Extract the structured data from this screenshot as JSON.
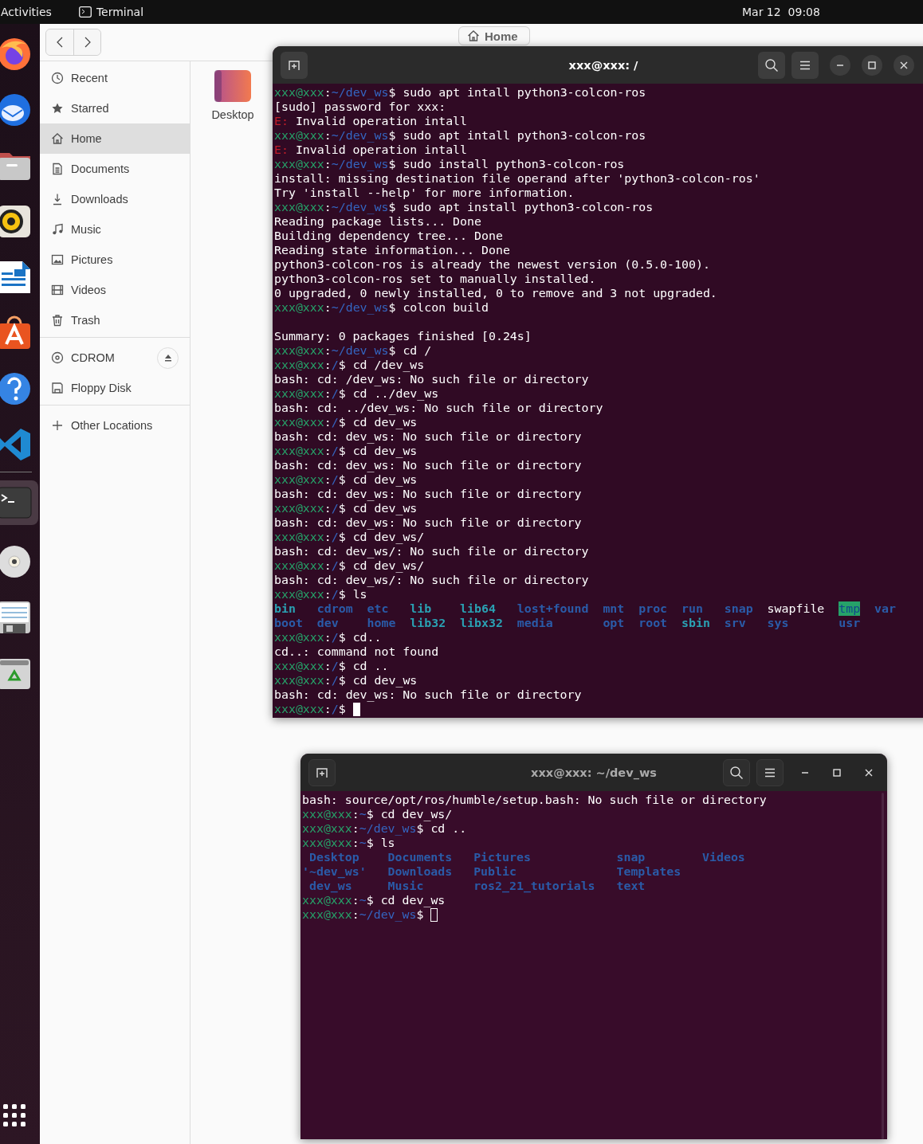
{
  "top_bar": {
    "activities": "Activities",
    "app": "Terminal",
    "clock": "Mar 12  09:08"
  },
  "dock": {
    "apps": [
      {
        "kind": "browser",
        "selected": false
      },
      {
        "kind": "mail",
        "selected": false
      },
      {
        "kind": "files",
        "selected": false
      },
      {
        "kind": "music",
        "selected": false
      },
      {
        "kind": "writer",
        "selected": false
      },
      {
        "kind": "store",
        "selected": false
      },
      {
        "kind": "help",
        "selected": false
      },
      {
        "kind": "code",
        "selected": false
      },
      {
        "kind": "terminal",
        "selected": true
      },
      {
        "kind": "disc",
        "selected": false
      },
      {
        "kind": "floppy",
        "selected": false
      },
      {
        "kind": "trash",
        "selected": false
      }
    ]
  },
  "file_manager": {
    "path_button": "Home",
    "sidebar": [
      [
        {
          "kind": "recent",
          "label": "Recent",
          "selected": false,
          "ejectable": false
        },
        {
          "kind": "starred",
          "label": "Starred",
          "selected": false,
          "ejectable": false
        },
        {
          "kind": "home",
          "label": "Home",
          "selected": true,
          "ejectable": false
        },
        {
          "kind": "documents",
          "label": "Documents",
          "selected": false,
          "ejectable": false
        },
        {
          "kind": "downloads",
          "label": "Downloads",
          "selected": false,
          "ejectable": false
        },
        {
          "kind": "music",
          "label": "Music",
          "selected": false,
          "ejectable": false
        },
        {
          "kind": "pictures",
          "label": "Pictures",
          "selected": false,
          "ejectable": false
        },
        {
          "kind": "videos",
          "label": "Videos",
          "selected": false,
          "ejectable": false
        },
        {
          "kind": "trash",
          "label": "Trash",
          "selected": false,
          "ejectable": false
        }
      ],
      [
        {
          "kind": "disc",
          "label": "CDROM",
          "selected": false,
          "ejectable": true
        },
        {
          "kind": "floppy",
          "label": "Floppy Disk",
          "selected": false,
          "ejectable": false
        }
      ],
      [
        {
          "kind": "add",
          "label": "Other Locations",
          "selected": false,
          "ejectable": false
        }
      ]
    ],
    "files": [
      {
        "name": "Desktop"
      }
    ]
  },
  "terminals": [
    {
      "title": "xxx@xxx: /",
      "focused": true,
      "lines": [
        {
          "kind": "prompt",
          "user": "xxx@xxx",
          "sep": ":",
          "path": "~/dev_ws",
          "rest": "$ sudo apt intall python3-colcon-ros"
        },
        {
          "kind": "text",
          "text": "[sudo] password for xxx:"
        },
        {
          "kind": "error",
          "tag": "E:",
          "text": "Invalid operation intall"
        },
        {
          "kind": "prompt",
          "user": "xxx@xxx",
          "sep": ":",
          "path": "~/dev_ws",
          "rest": "$ sudo apt intall python3-colcon-ros"
        },
        {
          "kind": "error",
          "tag": "E:",
          "text": "Invalid operation intall"
        },
        {
          "kind": "prompt",
          "user": "xxx@xxx",
          "sep": ":",
          "path": "~/dev_ws",
          "rest": "$ sudo install python3-colcon-ros"
        },
        {
          "kind": "text",
          "text": "install: missing destination file operand after 'python3-colcon-ros'"
        },
        {
          "kind": "text",
          "text": "Try 'install --help' for more information."
        },
        {
          "kind": "prompt",
          "user": "xxx@xxx",
          "sep": ":",
          "path": "~/dev_ws",
          "rest": "$ sudo apt install python3-colcon-ros"
        },
        {
          "kind": "text",
          "text": "Reading package lists... Done"
        },
        {
          "kind": "text",
          "text": "Building dependency tree... Done"
        },
        {
          "kind": "text",
          "text": "Reading state information... Done"
        },
        {
          "kind": "text",
          "text": "python3-colcon-ros is already the newest version (0.5.0-100)."
        },
        {
          "kind": "text",
          "text": "python3-colcon-ros set to manually installed."
        },
        {
          "kind": "text",
          "text": "0 upgraded, 0 newly installed, 0 to remove and 3 not upgraded."
        },
        {
          "kind": "prompt",
          "user": "xxx@xxx",
          "sep": ":",
          "path": "~/dev_ws",
          "rest": "$ colcon build"
        },
        {
          "kind": "blank"
        },
        {
          "kind": "text",
          "text": "Summary: 0 packages finished [0.24s]"
        },
        {
          "kind": "prompt",
          "user": "xxx@xxx",
          "sep": ":",
          "path": "~/dev_ws",
          "rest": "$ cd /"
        },
        {
          "kind": "prompt",
          "user": "xxx@xxx",
          "sep": ":",
          "path": "/",
          "rest": "$ cd /dev_ws"
        },
        {
          "kind": "text",
          "text": "bash: cd: /dev_ws: No such file or directory"
        },
        {
          "kind": "prompt",
          "user": "xxx@xxx",
          "sep": ":",
          "path": "/",
          "rest": "$ cd ../dev_ws"
        },
        {
          "kind": "text",
          "text": "bash: cd: ../dev_ws: No such file or directory"
        },
        {
          "kind": "prompt",
          "user": "xxx@xxx",
          "sep": ":",
          "path": "/",
          "rest": "$ cd dev_ws"
        },
        {
          "kind": "text",
          "text": "bash: cd: dev_ws: No such file or directory"
        },
        {
          "kind": "prompt",
          "user": "xxx@xxx",
          "sep": ":",
          "path": "/",
          "rest": "$ cd dev_ws"
        },
        {
          "kind": "text",
          "text": "bash: cd: dev_ws: No such file or directory"
        },
        {
          "kind": "prompt",
          "user": "xxx@xxx",
          "sep": ":",
          "path": "/",
          "rest": "$ cd dev_ws"
        },
        {
          "kind": "text",
          "text": "bash: cd: dev_ws: No such file or directory"
        },
        {
          "kind": "prompt",
          "user": "xxx@xxx",
          "sep": ":",
          "path": "/",
          "rest": "$ cd dev_ws"
        },
        {
          "kind": "text",
          "text": "bash: cd: dev_ws: No such file or directory"
        },
        {
          "kind": "prompt",
          "user": "xxx@xxx",
          "sep": ":",
          "path": "/",
          "rest": "$ cd dev_ws/"
        },
        {
          "kind": "text",
          "text": "bash: cd: dev_ws/: No such file or directory"
        },
        {
          "kind": "prompt",
          "user": "xxx@xxx",
          "sep": ":",
          "path": "/",
          "rest": "$ cd dev_ws/"
        },
        {
          "kind": "text",
          "text": "bash: cd: dev_ws/: No such file or directory"
        },
        {
          "kind": "prompt",
          "user": "xxx@xxx",
          "sep": ":",
          "path": "/",
          "rest": "$ ls"
        },
        {
          "kind": "ls",
          "rows": [
            [
              {
                "text": "bin",
                "kind": "link"
              },
              {
                "text": "cdrom",
                "kind": "dir"
              },
              {
                "text": "etc",
                "kind": "dir"
              },
              {
                "text": "lib",
                "kind": "link"
              },
              {
                "text": "lib64",
                "kind": "link"
              },
              {
                "text": "lost+found",
                "kind": "dir"
              },
              {
                "text": "mnt",
                "kind": "dir"
              },
              {
                "text": "proc",
                "kind": "dir"
              },
              {
                "text": "run",
                "kind": "dir"
              },
              {
                "text": "snap",
                "kind": "dir"
              },
              {
                "text": "swapfile",
                "kind": "file"
              },
              {
                "text": "tmp",
                "kind": "sticky"
              },
              {
                "text": "var",
                "kind": "dir"
              }
            ],
            [
              {
                "text": "boot",
                "kind": "dir"
              },
              {
                "text": "dev",
                "kind": "dir"
              },
              {
                "text": "home",
                "kind": "dir"
              },
              {
                "text": "lib32",
                "kind": "link"
              },
              {
                "text": "libx32",
                "kind": "link"
              },
              {
                "text": "media",
                "kind": "dir"
              },
              {
                "text": "opt",
                "kind": "dir"
              },
              {
                "text": "root",
                "kind": "dir"
              },
              {
                "text": "sbin",
                "kind": "link"
              },
              {
                "text": "srv",
                "kind": "dir"
              },
              {
                "text": "sys",
                "kind": "dir"
              },
              {
                "text": "usr",
                "kind": "dir"
              }
            ]
          ]
        },
        {
          "kind": "prompt",
          "user": "xxx@xxx",
          "sep": ":",
          "path": "/",
          "rest": "$ cd.."
        },
        {
          "kind": "text",
          "text": "cd..: command not found"
        },
        {
          "kind": "prompt",
          "user": "xxx@xxx",
          "sep": ":",
          "path": "/",
          "rest": "$ cd .."
        },
        {
          "kind": "prompt",
          "user": "xxx@xxx",
          "sep": ":",
          "path": "/",
          "rest": "$ cd dev_ws"
        },
        {
          "kind": "text",
          "text": "bash: cd: dev_ws: No such file or directory"
        },
        {
          "kind": "prompt",
          "user": "xxx@xxx",
          "sep": ":",
          "path": "/",
          "rest": "$ "
        }
      ]
    },
    {
      "title": "xxx@xxx: ~/dev_ws",
      "focused": false,
      "lines": [
        {
          "kind": "text",
          "text": "bash: source/opt/ros/humble/setup.bash: No such file or directory"
        },
        {
          "kind": "prompt",
          "user": "xxx@xxx",
          "sep": ":",
          "path": "~",
          "rest": "$ cd dev_ws/"
        },
        {
          "kind": "prompt",
          "user": "xxx@xxx",
          "sep": ":",
          "path": "~/dev_ws",
          "rest": "$ cd .."
        },
        {
          "kind": "prompt",
          "user": "xxx@xxx",
          "sep": ":",
          "path": "~",
          "rest": "$ ls"
        },
        {
          "kind": "ls",
          "rows": [
            [
              {
                "text": " Desktop",
                "kind": "dir"
              },
              {
                "text": " Documents",
                "kind": "dir"
              },
              {
                "text": " Pictures",
                "kind": "dir"
              },
              {
                "text": " snap",
                "kind": "dir"
              },
              {
                "text": " Videos",
                "kind": "dir"
              }
            ],
            [
              {
                "text": "'~dev_ws'",
                "kind": "dir"
              },
              {
                "text": " Downloads",
                "kind": "dir"
              },
              {
                "text": " Public",
                "kind": "dir"
              },
              {
                "text": " Templates",
                "kind": "dir"
              }
            ],
            [
              {
                "text": " dev_ws",
                "kind": "dir"
              },
              {
                "text": " Music",
                "kind": "dir"
              },
              {
                "text": " ros2_21_tutorials",
                "kind": "dir"
              },
              {
                "text": " text",
                "kind": "dir"
              }
            ]
          ]
        },
        {
          "kind": "prompt",
          "user": "xxx@xxx",
          "sep": ":",
          "path": "~",
          "rest": "$ cd dev_ws"
        },
        {
          "kind": "prompt",
          "user": "xxx@xxx",
          "sep": ":",
          "path": "~/dev_ws",
          "rest": "$ "
        }
      ]
    }
  ]
}
